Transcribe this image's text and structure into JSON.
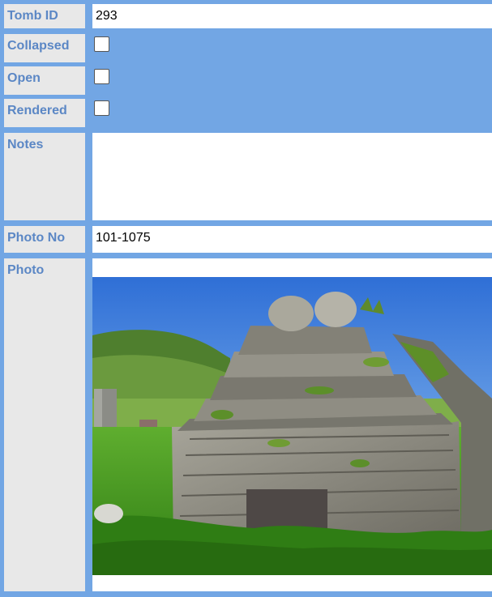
{
  "fields": {
    "tomb_id": {
      "label": "Tomb ID",
      "value": "293"
    },
    "collapsed": {
      "label": "Collapsed",
      "checked": false
    },
    "open": {
      "label": "Open",
      "checked": false
    },
    "rendered": {
      "label": "Rendered",
      "checked": false
    },
    "notes": {
      "label": "Notes",
      "value": ""
    },
    "photo_no": {
      "label": "Photo No",
      "value": "101-1075"
    },
    "photo": {
      "label": "Photo",
      "description": "stone tomb ruin in grassy graveyard"
    }
  },
  "colors": {
    "frame": "#72a6e4",
    "label_bg": "#e8e8e8",
    "label_text": "#5b87c5",
    "value_bg": "#ffffff"
  }
}
